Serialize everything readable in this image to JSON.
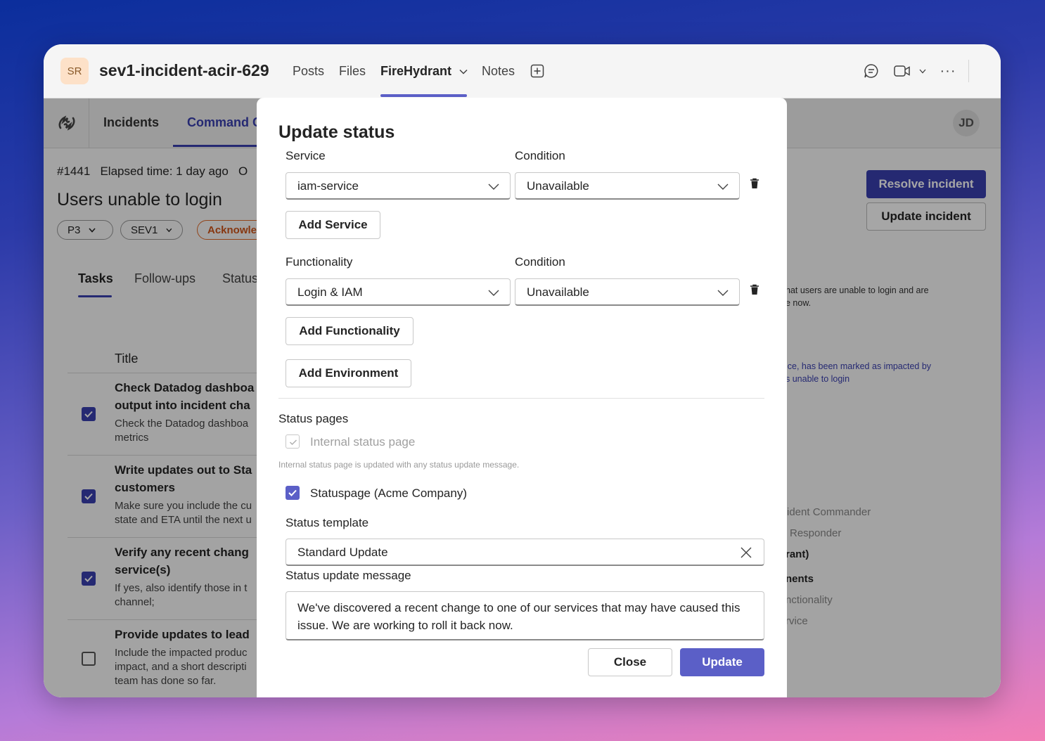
{
  "teams": {
    "avatar_initials": "SR",
    "channel_name": "sev1-incident-acir-629",
    "tabs": [
      "Posts",
      "Files",
      "FireHydrant",
      "Notes"
    ],
    "active_tab": "FireHydrant"
  },
  "app": {
    "nav": {
      "incidents": "Incidents",
      "command_center": "Command C"
    },
    "user_initials": "JD",
    "incident_number": "#1441",
    "elapsed": "Elapsed time: 1 day ago",
    "meta_extra": "O",
    "incident_title": "Users unable to login",
    "pills": {
      "priority": "P3",
      "severity": "SEV1",
      "status": "Acknowled"
    },
    "buttons": {
      "resolve": "Resolve incident",
      "update": "Update incident"
    },
    "subtabs": {
      "tasks": "Tasks",
      "followups": "Follow-ups",
      "status": "Status"
    },
    "table_header": "Title",
    "tasks": [
      {
        "title1": "Check Datadog dashboa",
        "title2": "output into incident cha",
        "desc1": "Check the Datadog dashboa",
        "desc2": "metrics",
        "checked": true
      },
      {
        "title1": "Write updates out to Sta",
        "title2": "customers",
        "desc1": "Make sure you include the cu",
        "desc2": "state and ETA until the next u",
        "checked": true
      },
      {
        "title1": "Verify any recent chang",
        "title2": "service(s)",
        "desc1": "If yes, also identify those in t",
        "desc2": "channel;",
        "checked": true
      },
      {
        "title1": "Provide updates to lead",
        "title2": "",
        "desc1": "Include the impacted produc",
        "desc2": "impact, and a short descripti",
        "desc3": "team has done so far.",
        "checked": false
      }
    ],
    "right_panel": {
      "summary1": "hat users are unable to login and are",
      "summary2": "e now.",
      "impact1": "ice, has been marked as impacted by",
      "impact2": "s unable to login",
      "role1": "ident Commander",
      "role2": "Responder",
      "heading1": "rant)",
      "heading2": "nents",
      "item1": "nctionality",
      "item2": "rvice"
    }
  },
  "modal": {
    "title": "Update status",
    "service_label": "Service",
    "condition_label": "Condition",
    "service_value": "iam-service",
    "service_condition": "Unavailable",
    "add_service": "Add Service",
    "functionality_label": "Functionality",
    "functionality_value": "Login & IAM",
    "functionality_condition": "Unavailable",
    "add_functionality": "Add Functionality",
    "add_environment": "Add Environment",
    "status_pages_label": "Status pages",
    "internal_status_page": "Internal status page",
    "internal_hint": "Internal status page is updated with any status update message.",
    "statuspage": "Statuspage (Acme Company)",
    "status_template_label": "Status template",
    "status_template_value": "Standard Update",
    "message_label": "Status update message",
    "message_value": "We've discovered a recent change to one of our services that may have caused this issue. We are working to roll it back now.",
    "close": "Close",
    "update": "Update"
  },
  "colors": {
    "accent": "#5b5fc7",
    "brand_dark": "#3a3fb0",
    "ack": "#d0551a"
  }
}
